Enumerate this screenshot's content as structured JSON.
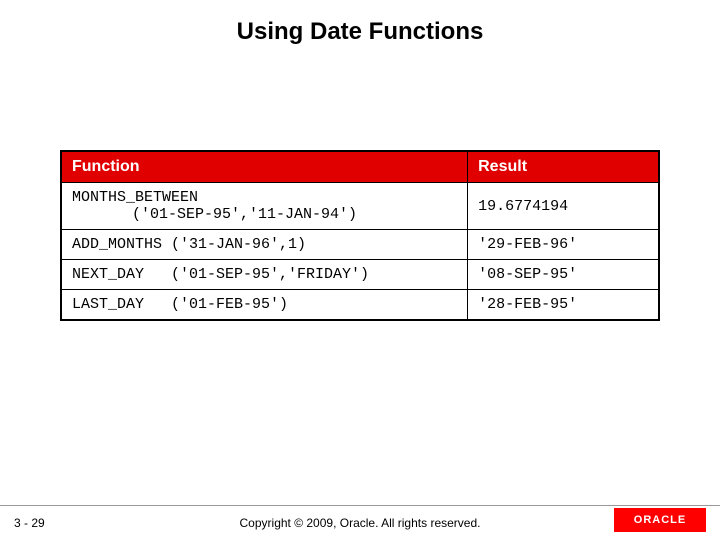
{
  "title": "Using Date Functions",
  "table": {
    "headers": {
      "function": "Function",
      "result": "Result"
    },
    "rows": [
      {
        "fn_name": "MONTHS_BETWEEN",
        "fn_args": "('01-SEP-95','11-JAN-94')",
        "result": "19.6774194"
      },
      {
        "fn_name": "ADD_MONTHS",
        "fn_args": "('31-JAN-96',1)",
        "result": "'29-FEB-96'"
      },
      {
        "fn_name": "NEXT_DAY",
        "fn_args": "('01-SEP-95','FRIDAY')",
        "result": "'08-SEP-95'"
      },
      {
        "fn_name": "LAST_DAY",
        "fn_args": "('01-FEB-95')",
        "result": "'28-FEB-95'"
      }
    ]
  },
  "footer": {
    "page_number": "3 - 29",
    "copyright": "Copyright © 2009, Oracle. All rights reserved.",
    "logo_text": "ORACLE"
  },
  "chart_data": {
    "type": "table",
    "title": "Using Date Functions",
    "columns": [
      "Function",
      "Result"
    ],
    "rows": [
      [
        "MONTHS_BETWEEN ('01-SEP-95','11-JAN-94')",
        "19.6774194"
      ],
      [
        "ADD_MONTHS ('31-JAN-96',1)",
        "'29-FEB-96'"
      ],
      [
        "NEXT_DAY ('01-SEP-95','FRIDAY')",
        "'08-SEP-95'"
      ],
      [
        "LAST_DAY ('01-FEB-95')",
        "'28-FEB-95'"
      ]
    ]
  }
}
